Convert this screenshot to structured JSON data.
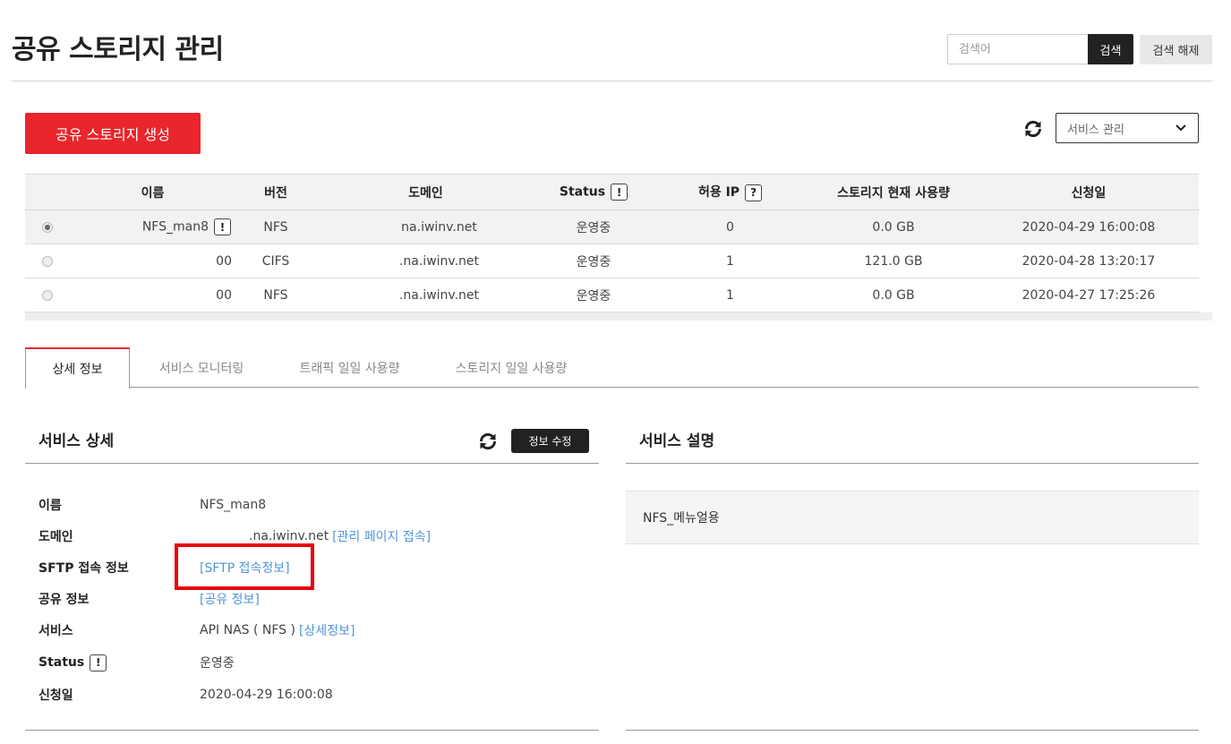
{
  "header": {
    "title": "공유 스토리지 관리",
    "search_placeholder": "검색어",
    "search_label": "검색",
    "search_clear_label": "검색 해제"
  },
  "toolbar": {
    "create_label": "공유 스토리지 생성",
    "service_select_value": "서비스 관리"
  },
  "table": {
    "columns": [
      "이름",
      "버전",
      "도메인",
      "Status",
      "허용 IP",
      "스토리지 현재 사용량",
      "신청일"
    ],
    "rows": [
      {
        "name": "NFS_man8",
        "version": "NFS",
        "domain": "na.iwinv.net",
        "status": "운영중",
        "allowed_ip": "0",
        "usage": "0.0 GB",
        "date": "2020-04-29 16:00:08"
      },
      {
        "name": "00",
        "version": "CIFS",
        "domain": ".na.iwinv.net",
        "status": "운영중",
        "allowed_ip": "1",
        "usage": "121.0 GB",
        "date": "2020-04-28 13:20:17"
      },
      {
        "name": "00",
        "version": "NFS",
        "domain": ".na.iwinv.net",
        "status": "운영중",
        "allowed_ip": "1",
        "usage": "0.0 GB",
        "date": "2020-04-27 17:25:26"
      }
    ],
    "status_info_mark": "!",
    "ip_info_mark": "?"
  },
  "tabs": [
    {
      "label": "상세 정보"
    },
    {
      "label": "서비스 모니터링"
    },
    {
      "label": "트래픽 일일 사용량"
    },
    {
      "label": "스토리지 일일 사용량"
    }
  ],
  "detail": {
    "title": "서비스 상세",
    "edit_label": "정보 수정",
    "rows": {
      "name_label": "이름",
      "name_value": "NFS_man8",
      "domain_label": "도메인",
      "domain_value": ".na.iwinv.net",
      "domain_link": "[관리 페이지 접속]",
      "sftp_label": "SFTP 접속 정보",
      "sftp_link": "[SFTP 접속정보]",
      "share_label": "공유 정보",
      "share_link": "[공유 정보]",
      "service_label": "서비스",
      "service_value": "API NAS ( NFS )",
      "service_link": "[상세정보]",
      "status_label": "Status",
      "status_value": "운영중",
      "date_label": "신청일",
      "date_value": "2020-04-29 16:00:08"
    }
  },
  "description": {
    "title": "서비스 설명",
    "text": "NFS_메뉴얼용"
  },
  "colors": {
    "accent": "#e8262b",
    "link": "#4f95d8",
    "dark": "#222222"
  }
}
